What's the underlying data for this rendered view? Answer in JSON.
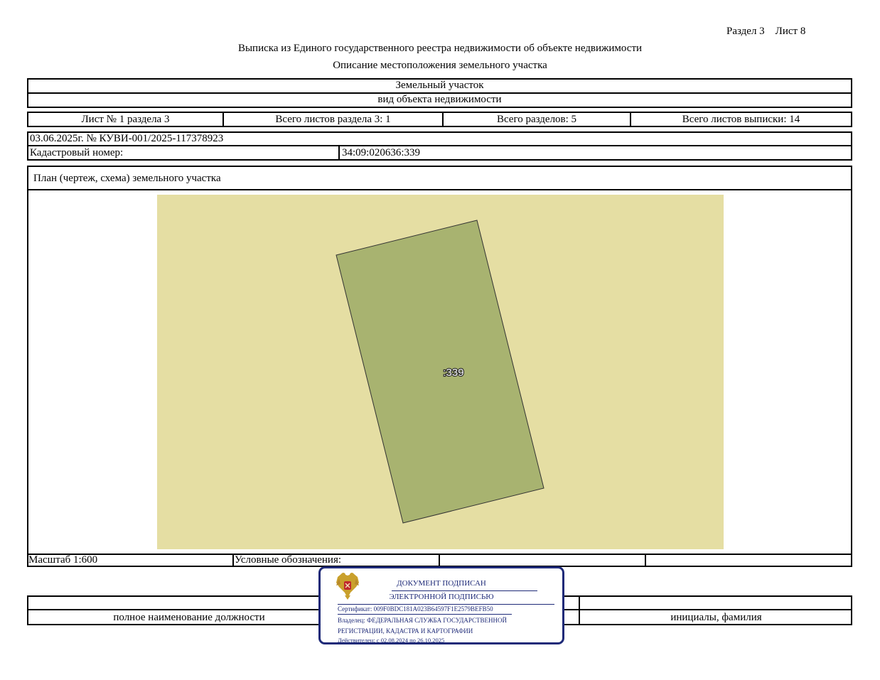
{
  "header": {
    "section_sheet": "Раздел 3    Лист 8",
    "title": "Выписка из Единого государственного реестра недвижимости об объекте недвижимости",
    "subtitle": "Описание местоположения земельного участка"
  },
  "object": {
    "type_value": "Земельный участок",
    "type_caption": "вид объекта недвижимости"
  },
  "sheets": {
    "sheet_of_section": "Лист № 1 раздела 3",
    "total_sheets_section": "Всего листов раздела 3: 1",
    "total_sections": "Всего разделов: 5",
    "total_sheets_extract": "Всего листов выписки: 14"
  },
  "record": {
    "date_number": "03.06.2025г. № КУВИ-001/2025-117378923",
    "cadastral_label": "Кадастровый номер:",
    "cadastral_value": "34:09:020636:339"
  },
  "plan": {
    "title": "План (чертеж, схема) земельного участка",
    "parcel_label": ":339",
    "background_color": "#e5dea3",
    "parcel_color": "#a8b370"
  },
  "footer": {
    "scale": "Масштаб 1:600",
    "legend_label": "Условные обозначения:",
    "position_caption": "полное наименование должности",
    "name_caption": "инициалы, фамилия"
  },
  "stamp": {
    "line1": "ДОКУМЕНТ ПОДПИСАН",
    "line2": "ЭЛЕКТРОННОЙ ПОДПИСЬЮ",
    "certificate": "Сертификат: 009F0BDC181A023B64597F1E2579BEFB50",
    "owner_line1": "Владелец: ФЕДЕРАЛЬНАЯ СЛУЖБА ГОСУДАРСТВЕННОЙ",
    "owner_line2": "РЕГИСТРАЦИИ, КАДАСТРА И КАРТОГРАФИИ",
    "valid": "Действителен: с 02.08.2024 по 26.10.2025",
    "border_color": "#1e2a78",
    "emblem": "russian-coat-of-arms-icon"
  }
}
